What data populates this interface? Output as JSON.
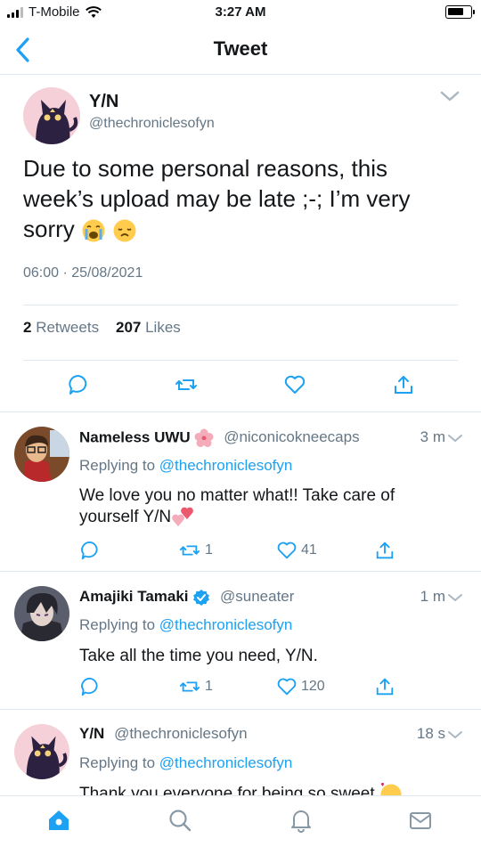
{
  "status_bar": {
    "carrier": "T-Mobile",
    "time": "3:27 AM"
  },
  "header": {
    "title": "Tweet"
  },
  "main_tweet": {
    "name": "Y/N",
    "handle": "@thechroniclesofyn",
    "text": "Due to some personal reasons, this week’s upload may be late ;-; I’m very sorry",
    "timestamp": "06:00 · 25/08/2021",
    "retweets_count": "2",
    "retweets_label": "Retweets",
    "likes_count": "207",
    "likes_label": "Likes"
  },
  "replies": [
    {
      "name": "Nameless UWU",
      "handle": "@niconicokneecaps",
      "age": "3 m",
      "replying_prefix": "Replying to",
      "replying_to": "@thechroniclesofyn",
      "text": "We love you no matter what!! Take care of yourself Y/N",
      "retweets": "1",
      "likes": "41"
    },
    {
      "name": "Amajiki Tamaki",
      "handle": "@suneater",
      "age": "1 m",
      "replying_prefix": "Replying to",
      "replying_to": "@thechroniclesofyn",
      "text": "Take all the time you need, Y/N.",
      "retweets": "1",
      "likes": "120"
    },
    {
      "name": "Y/N",
      "handle": "@thechroniclesofyn",
      "age": "18 s",
      "replying_prefix": "Replying to",
      "replying_to": "@thechroniclesofyn",
      "text": "Thank you everyone for being so sweet"
    }
  ],
  "colors": {
    "accent": "#1da1f2",
    "muted": "#657786",
    "text": "#14171a",
    "divider": "#e1e8ed",
    "heart_pink": "#e0245e",
    "verified": "#1da1f2"
  },
  "icons": [
    "back-chevron-icon",
    "reply-icon",
    "retweet-icon",
    "like-icon",
    "share-icon",
    "home-icon",
    "search-icon",
    "notifications-icon",
    "messages-icon",
    "verified-icon"
  ]
}
